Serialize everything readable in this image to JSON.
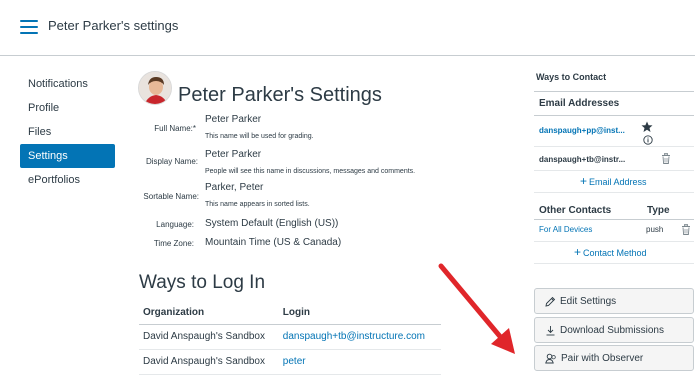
{
  "header": {
    "breadcrumb": "Peter Parker's settings"
  },
  "nav": {
    "items": [
      {
        "label": "Notifications"
      },
      {
        "label": "Profile"
      },
      {
        "label": "Files"
      },
      {
        "label": "Settings"
      },
      {
        "label": "ePortfolios"
      }
    ],
    "active_index": 3
  },
  "profile": {
    "title": "Peter Parker's Settings",
    "full_name_label": "Full Name:*",
    "full_name_value": "Peter Parker",
    "full_name_help": "This name will be used for grading.",
    "display_name_label": "Display Name:",
    "display_name_value": "Peter Parker",
    "display_name_help": "People will see this name in discussions, messages and comments.",
    "sortable_name_label": "Sortable Name:",
    "sortable_name_value": "Parker, Peter",
    "sortable_name_help": "This name appears in sorted lists.",
    "language_label": "Language:",
    "language_value": "System Default (English (US))",
    "timezone_label": "Time Zone:",
    "timezone_value": "Mountain Time (US & Canada)"
  },
  "logins": {
    "title": "Ways to Log In",
    "col_org": "Organization",
    "col_login": "Login",
    "rows": [
      {
        "org": "David Anspaugh's Sandbox",
        "login": "danspaugh+tb@instructure.com"
      },
      {
        "org": "David Anspaugh's Sandbox",
        "login": "peter"
      }
    ]
  },
  "contact": {
    "title": "Ways to Contact",
    "email_header": "Email Addresses",
    "emails": [
      "danspaugh+pp@inst...",
      "danspaugh+tb@instr..."
    ],
    "add_email": "Email Address",
    "other_header": "Other Contacts",
    "type_header": "Type",
    "other_name": "For All Devices",
    "other_type": "push",
    "add_method": "Contact Method"
  },
  "actions": {
    "edit": "Edit Settings",
    "download": "Download Submissions",
    "pair": "Pair with Observer"
  },
  "colors": {
    "accent": "#0374b5",
    "arrow": "#e0262a",
    "text": "#2d3b45"
  }
}
